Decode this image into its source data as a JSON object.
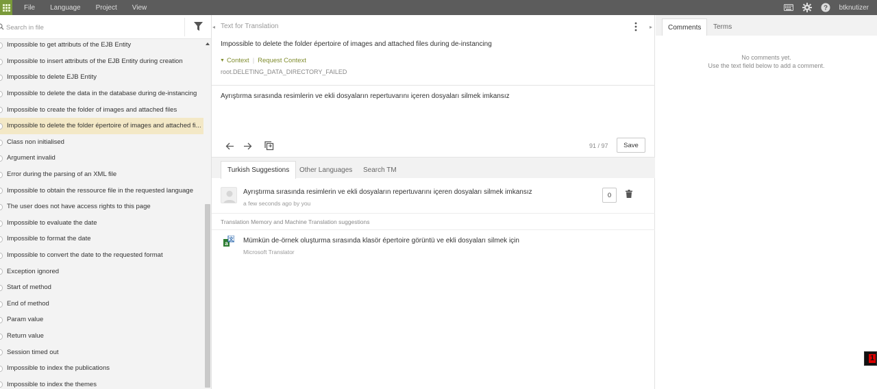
{
  "menu": [
    "File",
    "Language",
    "Project",
    "View"
  ],
  "user": "btknutizer",
  "search": {
    "placeholder": "Search in file"
  },
  "strings": [
    "Impossible to get attributs of the EJB Entity",
    "Impossible to insert attributs of the EJB Entity during creation",
    "Impossible to delete EJB Entity",
    "Impossible to delete the data in the database during de-instancing",
    "Impossible to create the folder of images and attached files",
    "Impossible to delete the folder épertoire of images and attached fi...",
    "Class non initialised",
    "Argument invalid",
    "Error during the parsing of an XML file",
    "Impossible to obtain the ressource file in the requested language",
    "The user does not have access rights to this page",
    "Impossible to evaluate the date",
    "Impossible to format the date",
    "Impossible to convert the date to the requested format",
    "Exception ignored",
    "Start of method",
    "End of method",
    "Param value",
    "Return value",
    "Session timed out",
    "Impossible to index the publications",
    "Impossible to index the themes"
  ],
  "selected_index": 5,
  "source": {
    "header": "Text for Translation",
    "text": "Impossible to delete the folder épertoire of images and attached files during de-instancing",
    "context_label": "Context",
    "request_context_label": "Request Context",
    "key": "root.DELETING_DATA_DIRECTORY_FAILED"
  },
  "translation": {
    "text": "Ayrıştırma sırasında resimlerin ve ekli dosyaların repertuvarını içeren dosyaları silmek imkansız",
    "counter": "91 / 97",
    "save_label": "Save"
  },
  "tabs": [
    "Turkish Suggestions",
    "Other Languages",
    "Search TM"
  ],
  "suggestion": {
    "text": "Ayrıştırma sırasında resimlerin ve ekli dosyaların repertuvarını içeren dosyaları silmek imkansız",
    "meta": "a few seconds ago by you",
    "votes": "0"
  },
  "tm_label": "Translation Memory and Machine Translation suggestions",
  "machine": {
    "text": "Mümkün de-örnek oluşturma sırasında klasör épertoire görüntü ve ekli dosyaları silmek için",
    "source": "Microsoft Translator"
  },
  "right_tabs": [
    "Comments",
    "Terms"
  ],
  "comments": {
    "empty_line1": "No comments yet.",
    "empty_line2": "Use the text field below to add a comment."
  },
  "colors": {
    "accent": "#7f8c2d",
    "selected_row": "#f3e8c6",
    "topbar": "#5c5c5c"
  }
}
